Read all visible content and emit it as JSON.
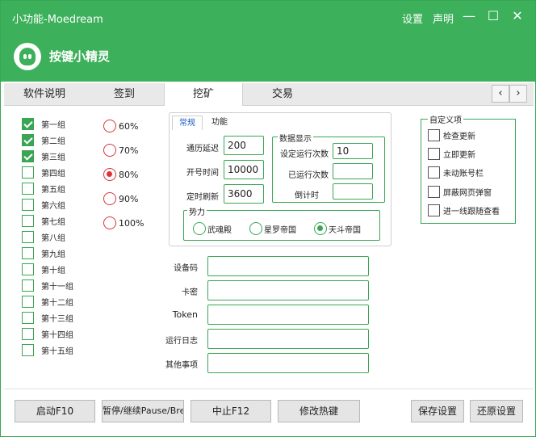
{
  "window": {
    "title": "小功能-Moedream",
    "links": {
      "settings": "设置",
      "statement": "声明"
    },
    "controls": {
      "minimize": "—",
      "maximize": "☐",
      "close": "✕"
    },
    "brand_name": "按键小精灵",
    "accent_color": "#3cb05a"
  },
  "tabs": [
    {
      "label": "软件说明"
    },
    {
      "label": "签到"
    },
    {
      "label": "挖矿",
      "active": true
    },
    {
      "label": "交易"
    }
  ],
  "tab_scroll": {
    "left": "‹",
    "right": "›"
  },
  "groups": [
    {
      "label": "第一组",
      "checked": true
    },
    {
      "label": "第二组",
      "checked": true
    },
    {
      "label": "第三组",
      "checked": true
    },
    {
      "label": "第四组",
      "checked": false
    },
    {
      "label": "第五组",
      "checked": false
    },
    {
      "label": "第六组",
      "checked": false
    },
    {
      "label": "第七组",
      "checked": false
    },
    {
      "label": "第八组",
      "checked": false
    },
    {
      "label": "第九组",
      "checked": false
    },
    {
      "label": "第十组",
      "checked": false
    },
    {
      "label": "第十一组",
      "checked": false
    },
    {
      "label": "第十二组",
      "checked": false
    },
    {
      "label": "第十三组",
      "checked": false
    },
    {
      "label": "第十四组",
      "checked": false
    },
    {
      "label": "第十五组",
      "checked": false
    }
  ],
  "percentages": [
    {
      "label": "60%",
      "selected": false
    },
    {
      "label": "70%",
      "selected": false
    },
    {
      "label": "80%",
      "selected": true
    },
    {
      "label": "90%",
      "selected": false
    },
    {
      "label": "100%",
      "selected": false
    }
  ],
  "subtabs": [
    {
      "label": "常规",
      "active": true
    },
    {
      "label": "功能",
      "active": false
    }
  ],
  "general": {
    "delay_label": "通历延迟",
    "delay_value": "200",
    "open_time_label": "开号时间",
    "open_time_value": "10000",
    "refresh_label": "定时刷新",
    "refresh_value": "3600"
  },
  "data_display": {
    "legend": "数据显示",
    "run_times_label": "设定运行次数",
    "run_times_value": "10",
    "done_times_label": "已运行次数",
    "done_times_value": "",
    "countdown_label": "倒计时",
    "countdown_value": ""
  },
  "power": {
    "legend": "势力",
    "options": [
      {
        "label": "武魂殿",
        "selected": false
      },
      {
        "label": "星罗帝国",
        "selected": false
      },
      {
        "label": "天斗帝国",
        "selected": true
      }
    ]
  },
  "info_fields": [
    {
      "label": "设备码",
      "value": ""
    },
    {
      "label": "卡密",
      "value": ""
    },
    {
      "label": "Token",
      "value": ""
    },
    {
      "label": "运行日志",
      "value": ""
    },
    {
      "label": "其他事项",
      "value": ""
    }
  ],
  "custom": {
    "legend": "自定义项",
    "options": [
      {
        "label": "检查更新",
        "checked": false
      },
      {
        "label": "立即更新",
        "checked": false
      },
      {
        "label": "未动账号栏",
        "checked": false
      },
      {
        "label": "屏蔽网页弹窗",
        "checked": false
      },
      {
        "label": "进一线跟随查看",
        "checked": false
      }
    ]
  },
  "buttons": {
    "start": "启动F10",
    "pause": "暂停/继续Pause/Break",
    "stop": "中止F12",
    "hotkey": "修改热键",
    "save": "保存设置",
    "restore": "还原设置"
  }
}
